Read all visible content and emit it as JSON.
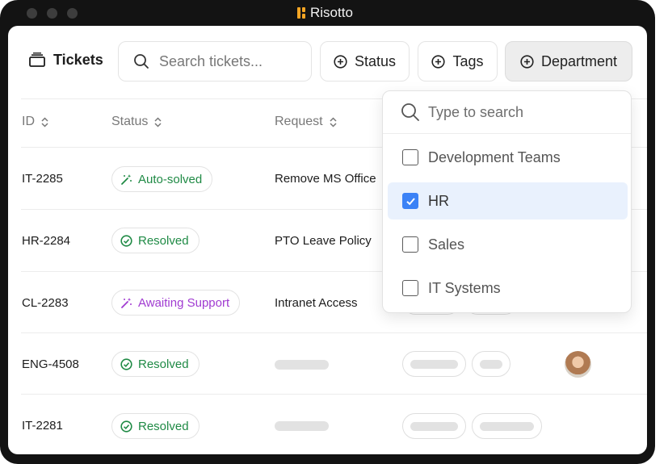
{
  "app": {
    "title": "Risotto"
  },
  "toolbar": {
    "tickets_label": "Tickets",
    "search_placeholder": "Search tickets...",
    "status_label": "Status",
    "tags_label": "Tags",
    "department_label": "Department"
  },
  "table": {
    "columns": [
      "ID",
      "Status",
      "Request"
    ],
    "rows": [
      {
        "id": "IT-2285",
        "status": "Auto-solved",
        "status_icon": "magic-wand-icon",
        "request": "Remove MS Office"
      },
      {
        "id": "HR-2284",
        "status": "Resolved",
        "status_icon": "check-circle-icon",
        "request": "PTO Leave Policy"
      },
      {
        "id": "CL-2283",
        "status": "Awaiting Support",
        "status_icon": "magic-wand-icon",
        "request": "Intranet Access"
      },
      {
        "id": "ENG-4508",
        "status": "Resolved",
        "status_icon": "check-circle-icon",
        "request": ""
      },
      {
        "id": "IT-2281",
        "status": "Resolved",
        "status_icon": "check-circle-icon",
        "request": ""
      }
    ]
  },
  "department_dropdown": {
    "search_placeholder": "Type to search",
    "options": [
      {
        "label": "Development Teams",
        "checked": false
      },
      {
        "label": "HR",
        "checked": true
      },
      {
        "label": "Sales",
        "checked": false
      },
      {
        "label": "IT Systems",
        "checked": false
      }
    ]
  },
  "colors": {
    "accent": "#3b82f6",
    "resolved": "#1f8a45",
    "awaiting": "#a03ad1",
    "logo": "#f5a524",
    "frame": "#131313"
  }
}
